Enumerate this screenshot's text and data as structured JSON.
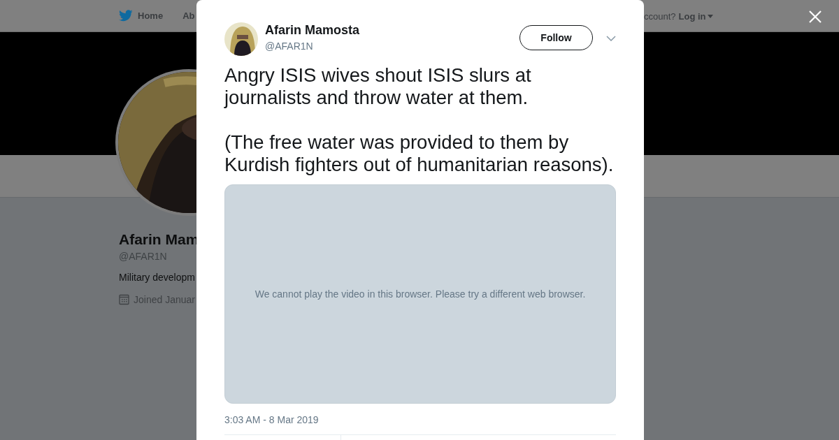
{
  "header": {
    "nav": [
      {
        "label": "Home",
        "kind": "home"
      },
      {
        "label": "Ab",
        "kind": "plain"
      }
    ],
    "login_prompt": "ccount?",
    "login_link": "Log in"
  },
  "profile": {
    "name": "Afarin Mam",
    "handle": "@AFAR1N",
    "bio": "Military developm",
    "joined": "Joined Januar"
  },
  "modal": {
    "author": {
      "name": "Afarin Mamosta",
      "handle": "@AFAR1N"
    },
    "follow_button": "Follow",
    "paragraphs": [
      "Angry ISIS wives shout ISIS slurs at journalists and throw water at them.",
      "(The free water was provided to them by Kurdish fighters out of humanitarian reasons)."
    ],
    "video": {
      "message": "We cannot play the video in this browser. Please try a different web browser."
    },
    "timestamp": "3:03 AM - 8 Mar 2019"
  }
}
